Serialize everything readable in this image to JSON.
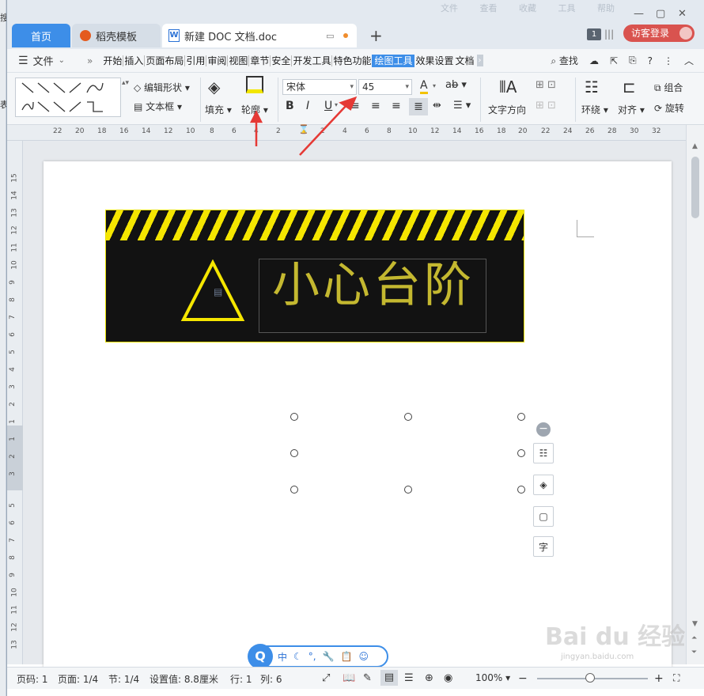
{
  "title_bar": {
    "ghost_menu": [
      "文件",
      "查看",
      "收藏",
      "工具",
      "帮助"
    ],
    "tabs": [
      {
        "label": "首页"
      },
      {
        "label": "稻壳模板"
      },
      {
        "label": "新建 DOC 文档.doc"
      }
    ],
    "add_tab": "+",
    "window_count": "1",
    "login_label": "访客登录"
  },
  "menu": {
    "file_label": "文件",
    "more": "»",
    "items": [
      "开始",
      "插入",
      "页面布局",
      "引用",
      "审阅",
      "视图",
      "章节",
      "安全",
      "开发工具",
      "特色功能",
      "绘图工具",
      "效果设置",
      "文档"
    ],
    "active": "绘图工具",
    "search_label": "查找",
    "help": "?"
  },
  "toolbar": {
    "edit_shape": "编辑形状",
    "text_box": "文本框",
    "fill": "填充",
    "outline": "轮廓",
    "font_name": "宋体",
    "font_size": "45",
    "text_direction": "文字方向",
    "wrap": "环绕",
    "align": "对齐",
    "group": "组合",
    "rotate": "旋转",
    "format_buttons": [
      "B",
      "I",
      "U"
    ]
  },
  "ruler": {
    "numbers": [
      "22",
      "20",
      "18",
      "16",
      "14",
      "12",
      "10",
      "8",
      "6",
      "4",
      "2",
      "2",
      "4",
      "6",
      "8",
      "10",
      "12",
      "14",
      "16",
      "18",
      "20",
      "22",
      "24",
      "26",
      "28",
      "30",
      "32"
    ]
  },
  "vertical_ruler": {
    "numbers": [
      "15",
      "14",
      "13",
      "12",
      "11",
      "10",
      "9",
      "8",
      "7",
      "6",
      "5",
      "4",
      "3",
      "2",
      "1",
      "1",
      "2",
      "3",
      "5",
      "6",
      "7",
      "8",
      "9",
      "10",
      "11",
      "12",
      "13",
      "14",
      "15"
    ]
  },
  "document": {
    "banner_text": "小心台阶"
  },
  "ime": {
    "logo": "Q",
    "mode": "中"
  },
  "status": {
    "page_code": "页码: 1",
    "page": "页面: 1/4",
    "section": "节: 1/4",
    "setting": "设置值: 8.8厘米",
    "row": "行: 1",
    "col": "列: 6",
    "zoom": "100%"
  },
  "watermark": {
    "main": "Bai du 经验",
    "sub": "jingyan.baidu.com"
  },
  "colors": {
    "accent": "#3d8ee8",
    "login": "#d9534f",
    "banner_bg": "#121212",
    "stripe_yellow": "#f5e600",
    "text_olive": "#c4b830",
    "annotation_red": "#e53935"
  }
}
